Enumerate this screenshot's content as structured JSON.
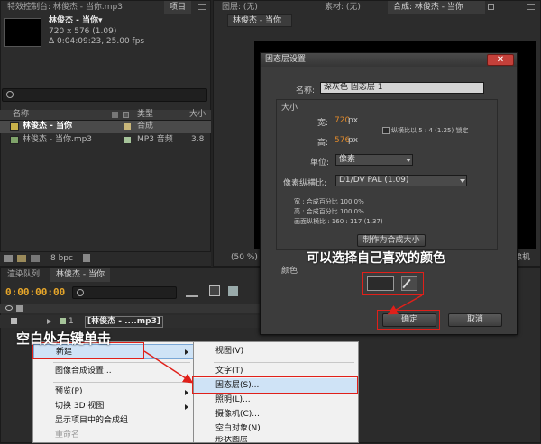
{
  "tabs": {
    "effects_control": "特效控制台: 林俊杰 - 当你.mp3",
    "project": "项目",
    "layer_none": "图层: (无)",
    "footage_none": "素材: (无)",
    "composition": "合成: 林俊杰 - 当你"
  },
  "comp_tab_label": "林俊杰 - 当你",
  "project_panel": {
    "thumb_title": "林俊杰 - 当你▾",
    "info_line1": "720 x 576 (1.09)",
    "info_line2": "Δ 0:04:09:23, 25.00 fps",
    "col_name": "名称",
    "col_type": "类型",
    "col_size": "大小",
    "items": [
      {
        "name": "林俊杰 - 当你",
        "type": "合成",
        "size": ""
      },
      {
        "name": "林俊杰 - 当你.mp3",
        "type": "MP3 音频",
        "size": "3.8"
      }
    ],
    "bpc": "8 bpc"
  },
  "viewer": {
    "zoom": "(50 %)",
    "camera_label": "像机"
  },
  "timeline": {
    "tab_render_queue": "渲染队列",
    "tab_comp": "林俊杰 - 当你",
    "timecode": "0:00:00:00",
    "layer_num": "1",
    "layer_name": "[林俊杰 - ....mp3]"
  },
  "dialog": {
    "title": "固态层设置",
    "name_label": "名称:",
    "name_value": "深灰色 固态层 1",
    "size_section": "大小",
    "width_label": "宽:",
    "width_value": "720",
    "height_label": "高:",
    "height_value": "576",
    "unit_px": "px",
    "lock_ratio": "纵横比以 5 : 4 (1.25) 锁定",
    "units_label": "单位:",
    "units_value": "像素",
    "par_label": "像素纵横比:",
    "par_value": "D1/DV PAL (1.09)",
    "info_width": "宽 : 合成百分比 100.0%",
    "info_height": "高 : 合成百分比 100.0%",
    "info_frame": "画面纵横比 : 160 : 117 (1.37)",
    "make_comp_size": "制作为合成大小",
    "color_section": "颜色",
    "ok": "确定",
    "cancel": "取消",
    "swatch_color": "#2b2b2b"
  },
  "context_menu": {
    "items": [
      {
        "label": "新建",
        "submenu": true,
        "disabled": false
      },
      {
        "label": "图像合成设置...",
        "submenu": false,
        "disabled": false
      },
      {
        "label": "预览(P)",
        "submenu": true,
        "disabled": false
      },
      {
        "label": "切换 3D 视图",
        "submenu": true,
        "disabled": false
      },
      {
        "label": "显示项目中的合成组",
        "submenu": false,
        "disabled": false
      },
      {
        "label": "重命名",
        "submenu": false,
        "disabled": true
      }
    ]
  },
  "submenu": {
    "items": [
      {
        "label": "视图(V)"
      },
      {
        "label": "文字(T)"
      },
      {
        "label": "固态层(S)..."
      },
      {
        "label": "照明(L)..."
      },
      {
        "label": "摄像机(C)..."
      },
      {
        "label": "空白对象(N)"
      },
      {
        "label": "形状图层"
      }
    ]
  },
  "annotations": {
    "right_click": "空白处右键单击",
    "choose_color": "可以选择自己喜欢的颜色"
  },
  "colors": {
    "accent_orange": "#e0892a",
    "annotation_red": "#e0201a"
  }
}
